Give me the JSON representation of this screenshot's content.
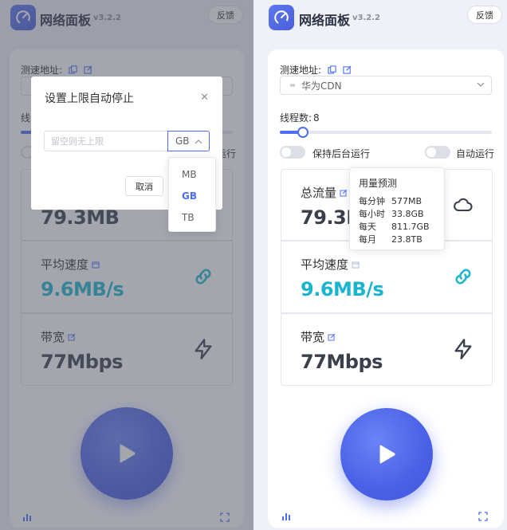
{
  "app": {
    "title": "网络面板",
    "version": "v3.2.2",
    "feedback_label": "反馈"
  },
  "settings": {
    "address_label": "测速地址:",
    "address_value": "华为CDN",
    "threads_label": "线程数:",
    "threads_value": "8",
    "thread_level_fraction": 0.08,
    "bg_run_label": "保持后台运行",
    "auto_run_label": "自动运行",
    "left_threads_label": "线",
    "left_auto_run_fragment": "运行"
  },
  "stats": {
    "total": {
      "label": "总流量",
      "value": "79.3MB",
      "icon": "cloud-icon"
    },
    "avg": {
      "label": "平均速度",
      "value": "9.6MB/s",
      "icon": "link-icon"
    },
    "bandwidth": {
      "label": "带宽",
      "value": "77Mbps",
      "icon": "lightning-icon"
    }
  },
  "dialog": {
    "title": "设置上限自动停止",
    "input_placeholder": "留空则无上限",
    "unit_selected": "GB",
    "cancel_label": "取消",
    "units": [
      "MB",
      "GB",
      "TB"
    ]
  },
  "forecast": {
    "title": "用量预测",
    "rows": [
      {
        "k": "每分钟",
        "v": "577MB"
      },
      {
        "k": "每小时",
        "v": "33.8GB"
      },
      {
        "k": "每天",
        "v": "811.7GB"
      },
      {
        "k": "每月",
        "v": "23.8TB"
      }
    ]
  },
  "colors": {
    "accent": "#4c6ef5",
    "speed_value": "#1bb4cf"
  }
}
